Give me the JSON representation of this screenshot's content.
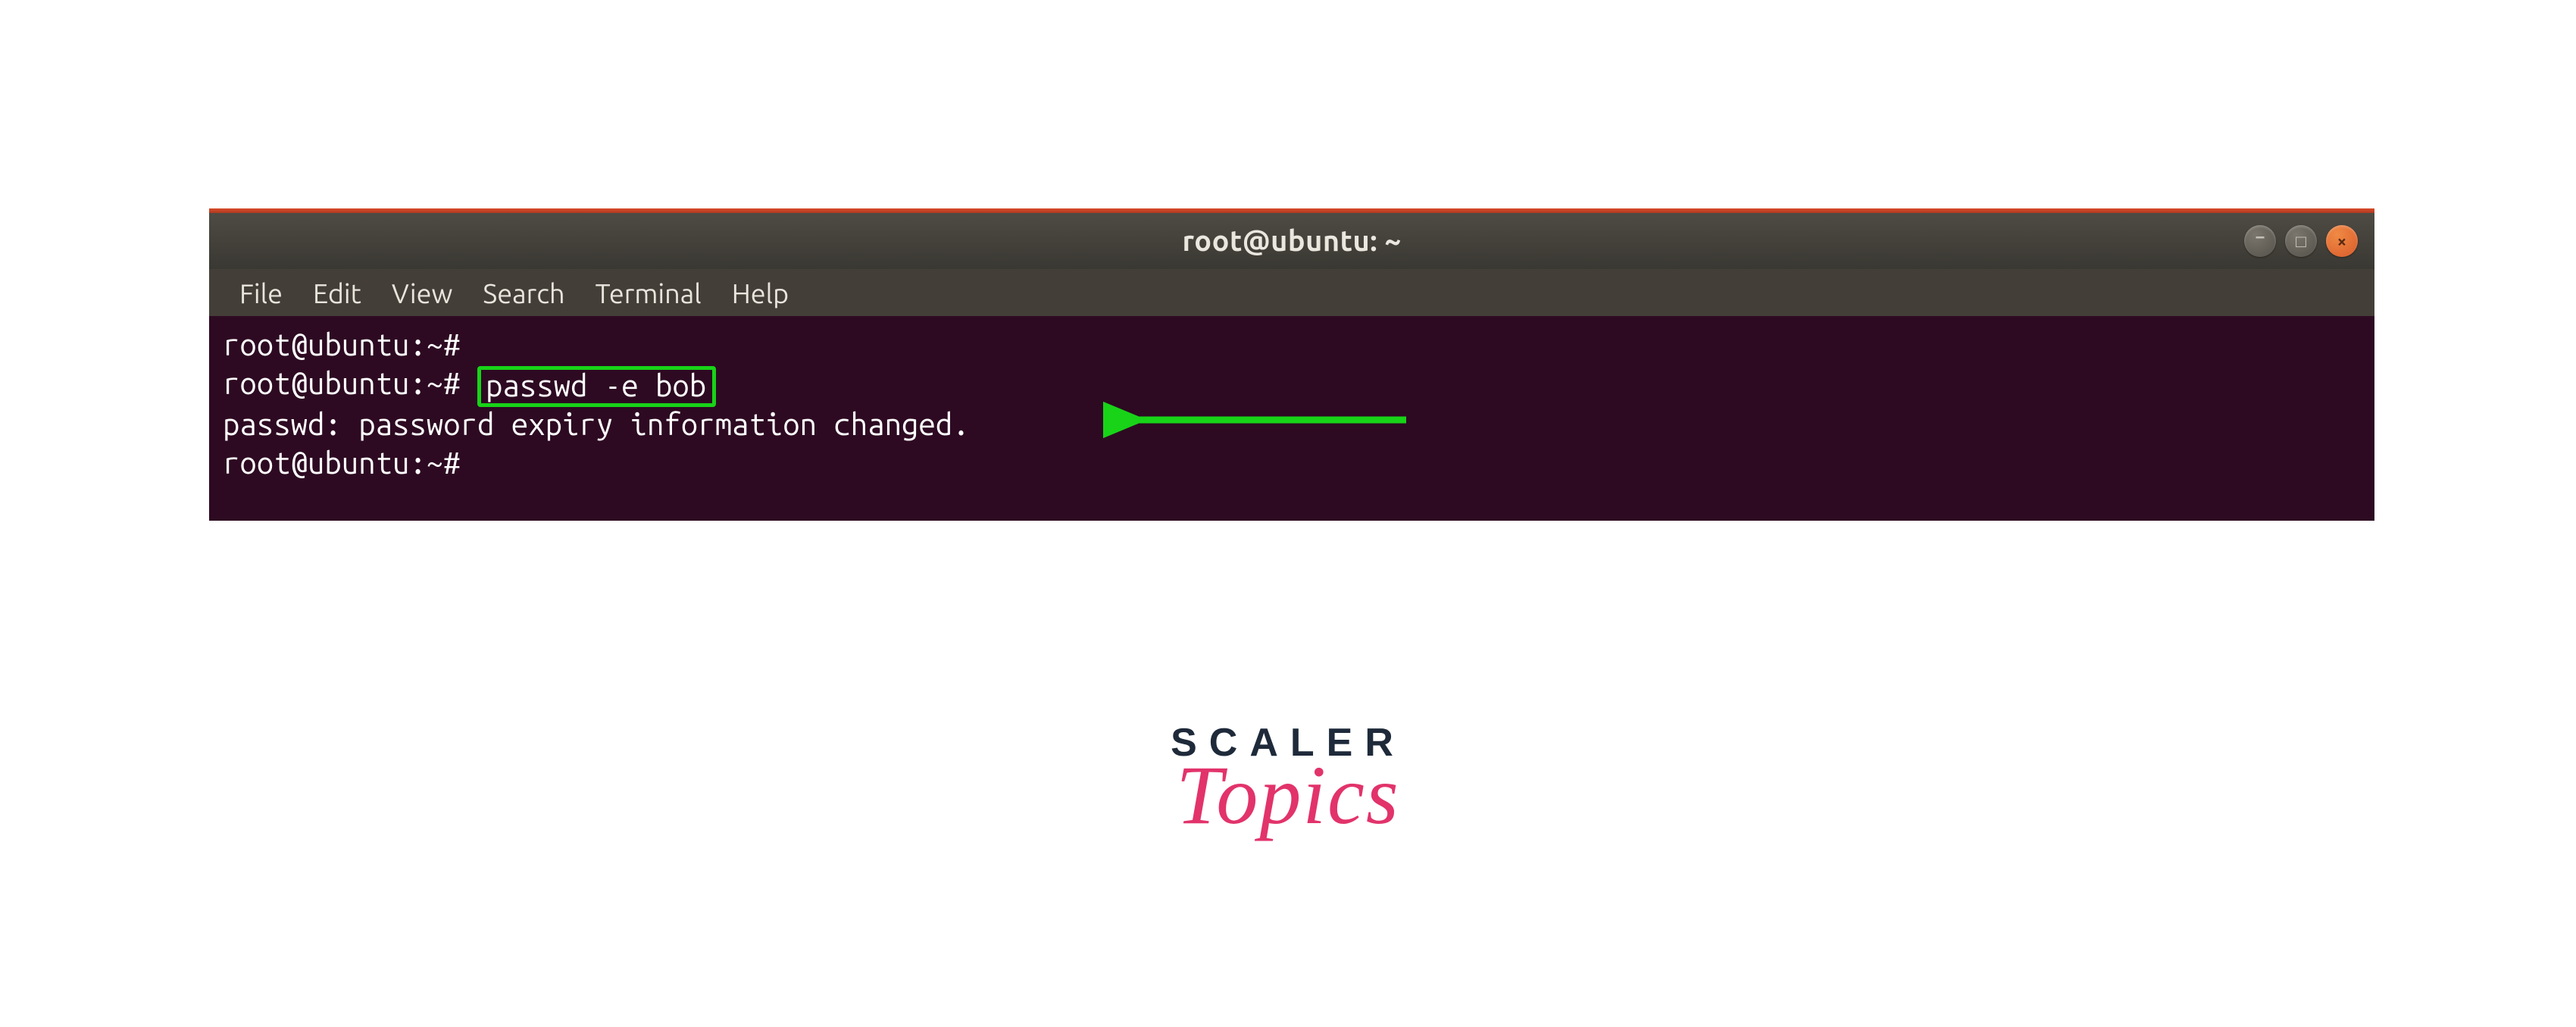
{
  "window": {
    "title": "root@ubuntu: ~",
    "controls": {
      "minimize": "–",
      "maximize": "□",
      "close": "×"
    }
  },
  "menubar": {
    "items": [
      "File",
      "Edit",
      "View",
      "Search",
      "Terminal",
      "Help"
    ]
  },
  "terminal": {
    "line1_prompt": "root@ubuntu:~#",
    "line2_prompt": "root@ubuntu:~# ",
    "line2_cmd": "passwd -e bob",
    "line3_output": "passwd: password expiry information changed.",
    "line4_prompt": "root@ubuntu:~#"
  },
  "annotations": {
    "highlight_color": "#18d318",
    "arrow_color": "#18d318"
  },
  "brand": {
    "top": "SCALER",
    "bottom": "Topics"
  }
}
